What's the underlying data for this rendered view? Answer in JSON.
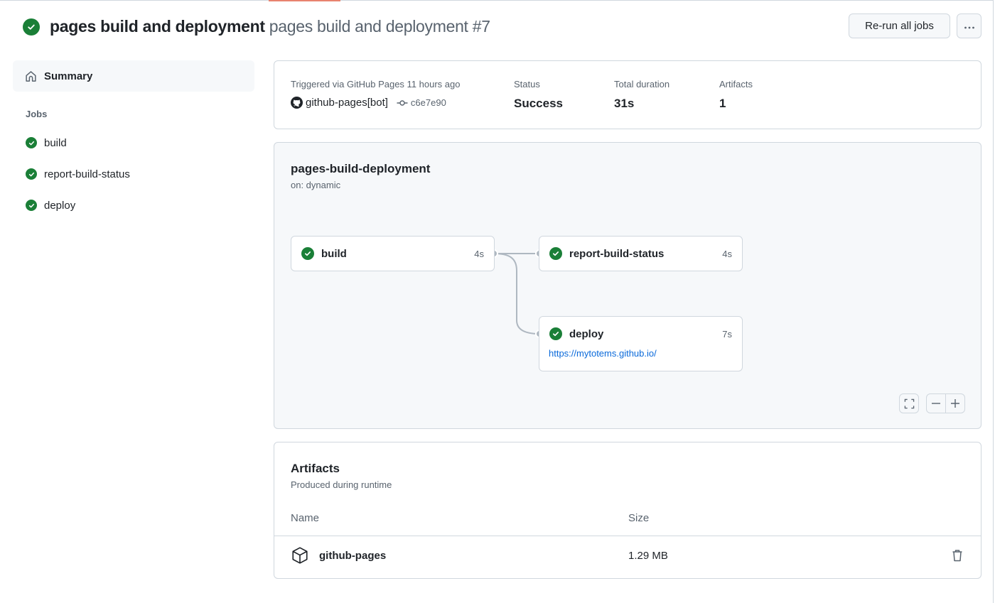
{
  "header": {
    "workflow_name": "pages build and deployment",
    "run_title": "pages build and deployment #7",
    "status_icon": "check-circle-icon",
    "rerun_label": "Re-run all jobs",
    "more_icon": "kebab-horizontal-icon"
  },
  "sidebar": {
    "summary_label": "Summary",
    "summary_icon": "home-icon",
    "jobs_heading": "Jobs",
    "jobs": [
      {
        "label": "build",
        "status": "success"
      },
      {
        "label": "report-build-status",
        "status": "success"
      },
      {
        "label": "deploy",
        "status": "success"
      }
    ]
  },
  "summary": {
    "trigger_text": "Triggered via GitHub Pages 11 hours ago",
    "actor": "github-pages[bot]",
    "commit_sha": "c6e7e90",
    "status_label": "Status",
    "status_value": "Success",
    "duration_label": "Total duration",
    "duration_value": "31s",
    "artifacts_label": "Artifacts",
    "artifacts_value": "1"
  },
  "workflow_graph": {
    "name": "pages-build-deployment",
    "trigger": "on: dynamic",
    "jobs": [
      {
        "name": "build",
        "duration": "4s",
        "status": "success"
      },
      {
        "name": "report-build-status",
        "duration": "4s",
        "status": "success"
      },
      {
        "name": "deploy",
        "duration": "7s",
        "status": "success",
        "link": "https://mytotems.github.io/"
      }
    ],
    "controls": {
      "fullscreen_icon": "screen-full-icon",
      "zoom_out_icon": "minus-icon",
      "zoom_in_icon": "plus-icon"
    }
  },
  "artifacts": {
    "title": "Artifacts",
    "subtitle": "Produced during runtime",
    "columns": [
      "Name",
      "Size"
    ],
    "rows": [
      {
        "name": "github-pages",
        "size": "1.29 MB",
        "icon": "package-icon"
      }
    ]
  },
  "colors": {
    "success": "#1a7f37",
    "link": "#0969da",
    "muted": "#59636e",
    "border": "#d0d7de",
    "canvas_subtle": "#f6f8fa"
  }
}
